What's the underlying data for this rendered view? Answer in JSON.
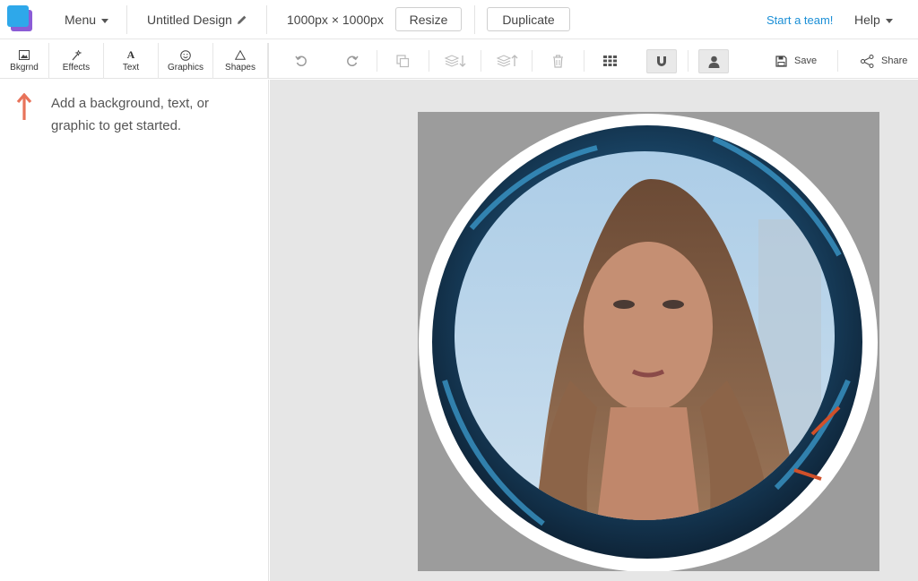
{
  "topbar": {
    "menu_label": "Menu",
    "design_title": "Untitled Design",
    "dimensions": "1000px × 1000px",
    "resize_label": "Resize",
    "duplicate_label": "Duplicate",
    "start_team_label": "Start a team!",
    "help_label": "Help"
  },
  "left_tabs": [
    {
      "label": "Bkgrnd",
      "icon": "image-icon"
    },
    {
      "label": "Effects",
      "icon": "magic-wand-icon"
    },
    {
      "label": "Text",
      "icon": "text-a-icon"
    },
    {
      "label": "Graphics",
      "icon": "smiley-icon"
    },
    {
      "label": "Shapes",
      "icon": "triangle-icon"
    }
  ],
  "toolbar": {
    "icons": [
      "undo-icon",
      "redo-icon",
      "copy-icon",
      "send-backward-icon",
      "bring-forward-icon",
      "trash-icon",
      "grid-icon",
      "magnet-icon",
      "person-icon"
    ],
    "save_label": "Save",
    "share_label": "Share"
  },
  "sidebar": {
    "hint_text": "Add a background, text, or graphic to get started."
  },
  "colors": {
    "accent_blue": "#1b8fd6",
    "hint_arrow": "#e8735a",
    "canvas_bg": "#e6e6e6",
    "artboard_bg": "#9c9c9c"
  }
}
